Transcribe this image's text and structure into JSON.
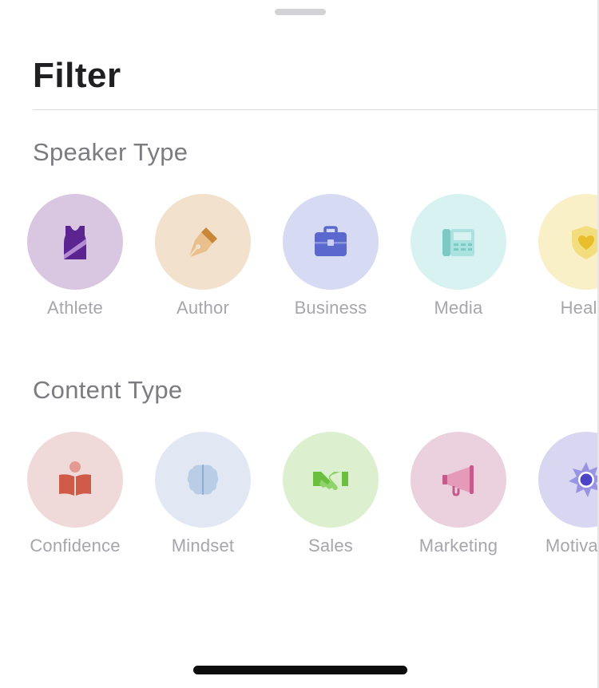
{
  "sheet": {
    "title": "Filter"
  },
  "speaker_type": {
    "title": "Speaker Type",
    "items": [
      {
        "label": "Athlete",
        "icon": "athlete-jersey-icon",
        "bg": "#d9c7e2",
        "fg": "#5b2491"
      },
      {
        "label": "Author",
        "icon": "fountain-pen-icon",
        "bg": "#f2e1cd",
        "fg": "#d8a160"
      },
      {
        "label": "Business",
        "icon": "briefcase-icon",
        "bg": "#d6dbf3",
        "fg": "#5b69cf"
      },
      {
        "label": "Media",
        "icon": "fax-machine-icon",
        "bg": "#d8f2f1",
        "fg": "#8fd4cf"
      },
      {
        "label": "Health",
        "icon": "shield-heart-icon",
        "bg": "#f9f0c8",
        "fg": "#f0d55a"
      }
    ]
  },
  "content_type": {
    "title": "Content Type",
    "items": [
      {
        "label": "Confidence",
        "icon": "reading-person-icon",
        "bg": "#f0d9d9",
        "fg": "#d15a4a"
      },
      {
        "label": "Mindset",
        "icon": "brain-icon",
        "bg": "#e2e8f3",
        "fg": "#b8cbe6"
      },
      {
        "label": "Sales",
        "icon": "handshake-icon",
        "bg": "#dcf0cf",
        "fg": "#6abf3e"
      },
      {
        "label": "Marketing",
        "icon": "megaphone-icon",
        "bg": "#ebd0de",
        "fg": "#c65a8a"
      },
      {
        "label": "Motivation",
        "icon": "sun-icon",
        "bg": "#d8d6f1",
        "fg": "#4b44c7"
      }
    ]
  }
}
